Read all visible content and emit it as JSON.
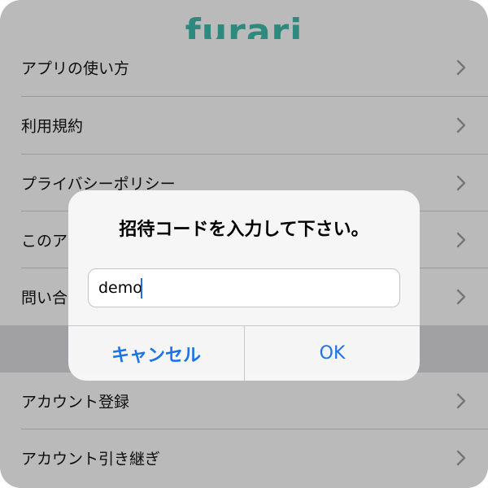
{
  "app": {
    "logo_text": "furari",
    "brand_color": "#3cb3a4"
  },
  "menu": {
    "items": [
      {
        "label": "アプリの使い方",
        "icon": "chevron-right-icon"
      },
      {
        "label": "利用規約",
        "icon": "chevron-right-icon"
      },
      {
        "label": "プライバシーポリシー",
        "icon": "chevron-right-icon"
      },
      {
        "label": "このア",
        "icon": "chevron-right-icon"
      },
      {
        "label": "問い合",
        "icon": "chevron-right-icon"
      },
      {
        "label": "アカウント登録",
        "icon": "chevron-right-icon"
      },
      {
        "label": "アカウント引き継ぎ",
        "icon": "chevron-right-icon"
      }
    ]
  },
  "dialog": {
    "title": "招待コードを入力して下さい。",
    "input_value": "demo",
    "cancel_label": "キャンセル",
    "ok_label": "OK",
    "accent_color": "#1a73e8"
  }
}
